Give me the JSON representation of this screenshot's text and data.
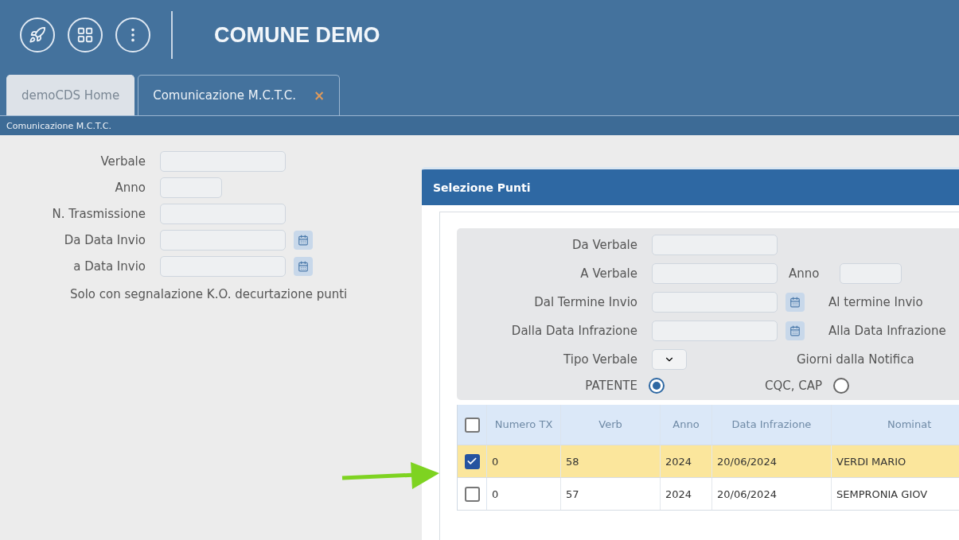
{
  "header": {
    "title": "COMUNE DEMO"
  },
  "tabs": [
    {
      "label": "demoCDS Home",
      "selected": false
    },
    {
      "label": "Comunicazione M.C.T.C.",
      "selected": true,
      "close": "×"
    }
  ],
  "breadcrumb": "Comunicazione M.C.T.C.",
  "form": {
    "fields": [
      {
        "label": "Verbale",
        "kind": "text"
      },
      {
        "label": "Anno",
        "kind": "short"
      },
      {
        "label": "N. Trasmissione",
        "kind": "text"
      },
      {
        "label": "Da Data Invio",
        "kind": "date"
      },
      {
        "label": "a Data Invio",
        "kind": "date"
      }
    ],
    "note": "Solo con segnalazione K.O. decurtazione punti"
  },
  "dialog": {
    "title": "Selezione Punti",
    "filters": [
      {
        "label": "Da Verbale",
        "kind": "text"
      },
      {
        "label": "A Verbale",
        "kind": "text",
        "side": {
          "label": "Anno",
          "kind": "short"
        }
      },
      {
        "label": "Dal Termine Invio",
        "kind": "date",
        "side": {
          "label": "Al termine Invio",
          "kind": "label"
        }
      },
      {
        "label": "Dalla Data Infrazione",
        "kind": "date",
        "side": {
          "label": "Alla Data Infrazione",
          "kind": "label"
        }
      },
      {
        "label": "Tipo Verbale",
        "kind": "select",
        "side": {
          "label": "Giorni dalla Notifica",
          "kind": "label"
        }
      }
    ],
    "radios": [
      {
        "label": "PATENTE",
        "selected": true
      },
      {
        "label": "CQC, CAP",
        "selected": false
      }
    ],
    "table": {
      "all_checked": false,
      "columns": [
        "Numero TX",
        "Verb",
        "Anno",
        "Data Infrazione",
        "Nominat"
      ],
      "rows": [
        {
          "checked": true,
          "cells": [
            "0",
            "58",
            "2024",
            "20/06/2024",
            "VERDI MARIO"
          ]
        },
        {
          "checked": false,
          "cells": [
            "0",
            "57",
            "2024",
            "20/06/2024",
            "SEMPRONIA GIOV"
          ]
        }
      ]
    }
  }
}
